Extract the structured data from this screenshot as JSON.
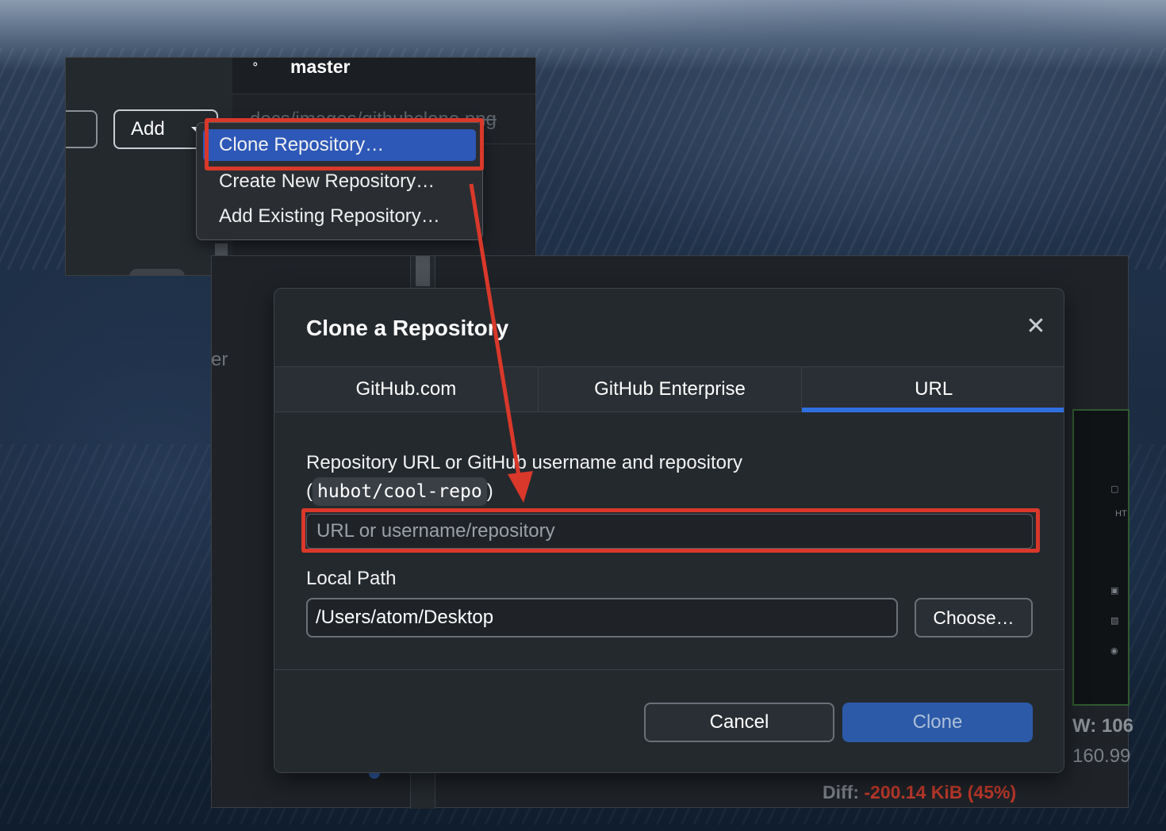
{
  "back_window": {
    "branch_name": "master",
    "branch_icon": "git-branch-icon",
    "add_button_label": "Add",
    "changed_file_path": "docs/images/githubclone.png",
    "add_menu": {
      "items": [
        {
          "label": "Clone Repository…",
          "selected": true
        },
        {
          "label": "Create New Repository…",
          "selected": false
        },
        {
          "label": "Add Existing Repository…",
          "selected": false
        }
      ]
    }
  },
  "middle_window": {
    "ghost_text": "er",
    "right_stat_1": "W: 106",
    "right_stat_2": "160.99",
    "diff_label": "Diff: ",
    "diff_value": "-200.14 KiB (45%)"
  },
  "dialog": {
    "title": "Clone a Repository",
    "close_icon": "close-icon",
    "tabs": [
      {
        "label": "GitHub.com",
        "active": false
      },
      {
        "label": "GitHub Enterprise",
        "active": false
      },
      {
        "label": "URL",
        "active": true
      }
    ],
    "url_label_line1": "Repository URL or GitHub username and repository",
    "url_label_open": "(",
    "url_example": "hubot/cool-repo",
    "url_label_close": ")",
    "url_input_placeholder": "URL or username/repository",
    "url_input_value": "",
    "local_path_label": "Local Path",
    "local_path_value": "/Users/atom/Desktop",
    "choose_button": "Choose…",
    "cancel_button": "Cancel",
    "clone_button": "Clone"
  },
  "colors": {
    "annotation_red": "#d9382a",
    "accent_blue": "#2f6fe0",
    "menu_selected": "#2d58b8"
  }
}
